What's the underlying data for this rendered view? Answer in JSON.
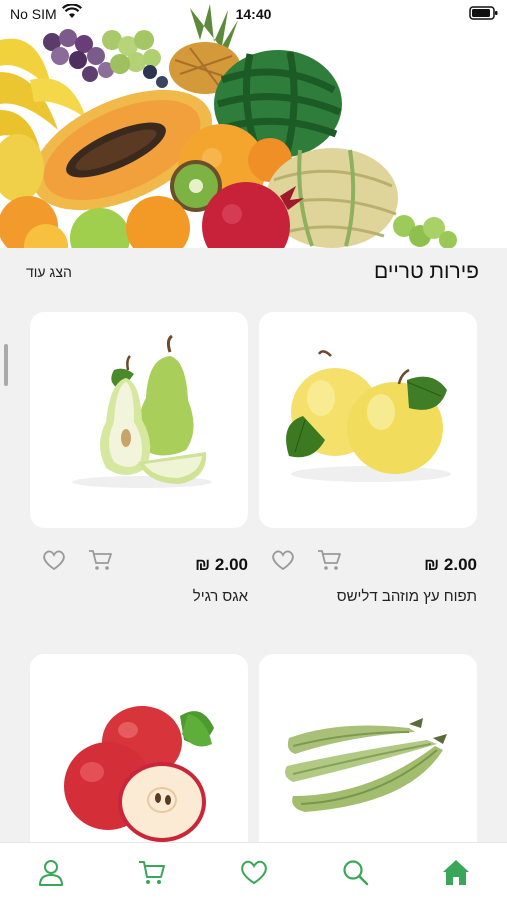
{
  "status_bar": {
    "carrier": "No SIM",
    "time": "14:40"
  },
  "hero": {
    "image": "fresh-fruits-banner"
  },
  "section": {
    "title": "פירות טריים",
    "show_more": "הצג עוד"
  },
  "products": [
    {
      "name": "תפוח עץ מוזהב דלישס",
      "price": "2.00 ₪",
      "image": "golden-apple"
    },
    {
      "name": "אגס רגיל",
      "price": "2.00 ₪",
      "image": "pear"
    },
    {
      "name": "",
      "price": "",
      "image": "plantain-banana"
    },
    {
      "name": "",
      "price": "",
      "image": "red-apple"
    }
  ],
  "bottom_nav": {
    "items": [
      "home-icon",
      "search-icon",
      "heart-icon",
      "cart-icon",
      "user-icon"
    ],
    "active": "home-icon"
  },
  "colors": {
    "accent": "#3aa65a",
    "content_bg": "#f1f1f1",
    "card_bg": "#ffffff",
    "icon_gray": "#9a9a9a"
  }
}
